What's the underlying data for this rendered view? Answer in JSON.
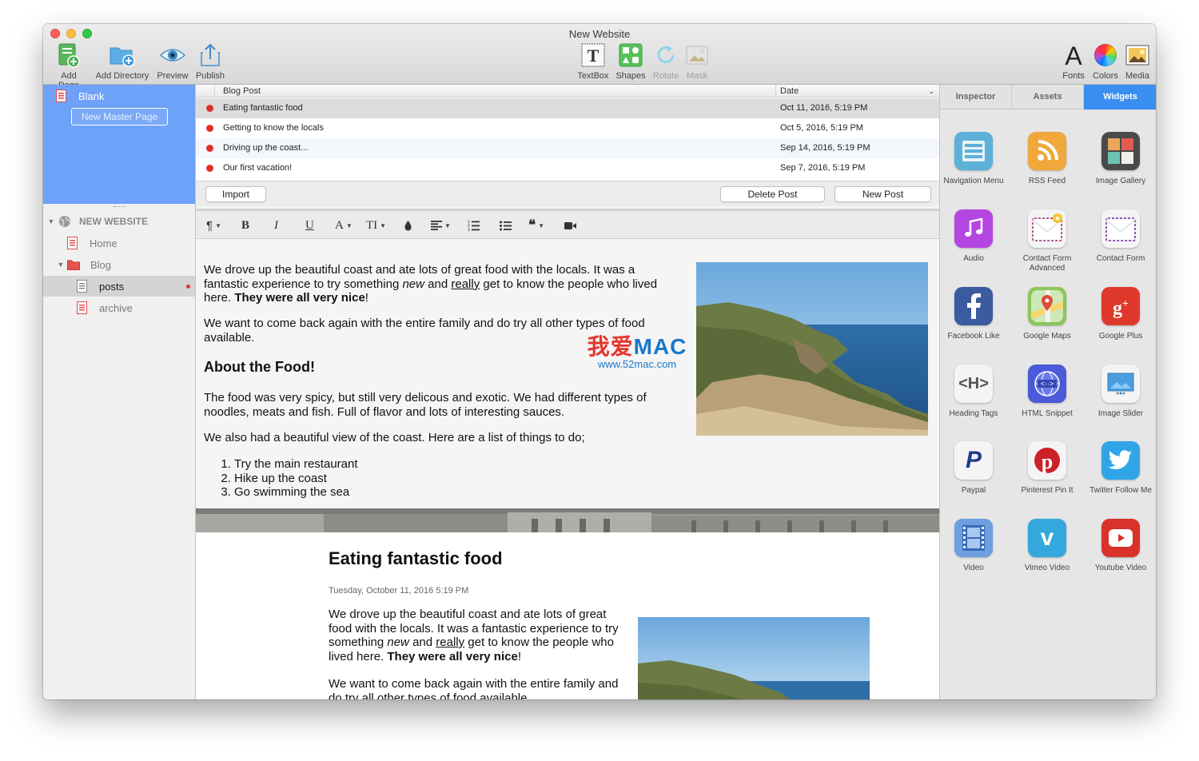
{
  "window": {
    "title": "New Website"
  },
  "toolbar": {
    "add_page": "Add Page",
    "add_directory": "Add Directory",
    "preview": "Preview",
    "publish": "Publish",
    "textbox": "TextBox",
    "shapes": "Shapes",
    "rotate": "Rotate",
    "mask": "Mask",
    "fonts": "Fonts",
    "colors": "Colors",
    "media": "Media"
  },
  "sidebar": {
    "master_page": "Blank",
    "new_master_button": "New Master Page",
    "site_name": "NEW WEBSITE",
    "items": [
      {
        "label": "Home"
      },
      {
        "label": "Blog"
      },
      {
        "label": "posts"
      },
      {
        "label": "archive"
      }
    ]
  },
  "posts_table": {
    "col_title": "Blog Post",
    "col_date": "Date",
    "rows": [
      {
        "title": "Eating fantastic food",
        "date": "Oct 11, 2016, 5:19 PM"
      },
      {
        "title": "Getting to know the locals",
        "date": "Oct 5, 2016, 5:19 PM"
      },
      {
        "title": "Driving up the coast...",
        "date": "Sep 14, 2016, 5:19 PM"
      },
      {
        "title": "Our first vacation!",
        "date": "Sep 7, 2016, 5:19 PM"
      }
    ],
    "import_button": "Import",
    "delete_button": "Delete Post",
    "new_button": "New Post"
  },
  "editor": {
    "p1_a": "We drove up the beautiful coast and ate lots of great food with the locals. It was a fantastic experience to try something ",
    "p1_em": "new",
    "p1_b": " and ",
    "p1_u": "really",
    "p1_c": " get to know the people who lived here. ",
    "p1_strong": "They were all very nice",
    "p1_d": "!",
    "p2": "We want to come back again with the entire family and do try all other types of food available.",
    "heading": "About the Food!",
    "p3": "The food was very spicy, but still very delicous and exotic. We had different types of noodles, meats and fish. Full of flavor and lots of interesting sauces.",
    "p4": "We also had a beautiful view of the coast. Here are a list of things to do;",
    "list": [
      "Try the main restaurant",
      "Hike up the coast",
      "Go swimming the sea"
    ]
  },
  "watermark": {
    "main_cn": "我爱",
    "main_en": "MAC",
    "sub": "www.52mac.com"
  },
  "preview": {
    "title": "Eating fantastic food",
    "date": "Tuesday, October 11, 2016 5:19 PM",
    "p1_a": "We drove up the beautiful coast and ate lots of great food with the locals. It was a fantastic experience to try something ",
    "p1_em": "new",
    "p1_b": " and ",
    "p1_u": "really",
    "p1_c": " get to know the people who lived here. ",
    "p1_strong": "They were all very nice",
    "p1_d": "!",
    "p2": "We want to come back again with the entire family and do try all other types of food available."
  },
  "right_panel": {
    "tabs": [
      "Inspector",
      "Assets",
      "Widgets"
    ],
    "active_tab": "Widgets",
    "widgets": [
      {
        "label": "Navigation Menu",
        "icon": "navigation-menu-icon",
        "color": "#5db0d8"
      },
      {
        "label": "RSS Feed",
        "icon": "rss-icon",
        "color": "#f0a83a"
      },
      {
        "label": "Image Gallery",
        "icon": "image-gallery-icon",
        "color": "#4a4a4a"
      },
      {
        "label": "Audio",
        "icon": "music-note-icon",
        "color": "#b545e0"
      },
      {
        "label": "Contact Form Advanced",
        "icon": "contact-form-advanced-icon",
        "color": "#f4f4f4"
      },
      {
        "label": "Contact Form",
        "icon": "contact-form-icon",
        "color": "#f4f4f4"
      },
      {
        "label": "Facebook Like",
        "icon": "facebook-icon",
        "color": "#3b5ba0"
      },
      {
        "label": "Google Maps",
        "icon": "google-maps-icon",
        "color": "#8cc65a"
      },
      {
        "label": "Google Plus",
        "icon": "google-plus-icon",
        "color": "#e0392b"
      },
      {
        "label": "Heading Tags",
        "icon": "heading-tags-icon",
        "color": "#f4f4f4"
      },
      {
        "label": "HTML Snippet",
        "icon": "html-snippet-icon",
        "color": "#4a5ad8"
      },
      {
        "label": "Image Slider",
        "icon": "image-slider-icon",
        "color": "#f4f4f4"
      },
      {
        "label": "Paypal",
        "icon": "paypal-icon",
        "color": "#f4f4f4"
      },
      {
        "label": "Pinterest Pin It",
        "icon": "pinterest-icon",
        "color": "#f4f4f4"
      },
      {
        "label": "Twitter Follow Me",
        "icon": "twitter-icon",
        "color": "#2fa5e8"
      },
      {
        "label": "Video",
        "icon": "film-icon",
        "color": "#6c9ee0"
      },
      {
        "label": "Vimeo Video",
        "icon": "vimeo-icon",
        "color": "#34a8dc"
      },
      {
        "label": "Youtube Video",
        "icon": "youtube-icon",
        "color": "#d9322a"
      }
    ]
  }
}
